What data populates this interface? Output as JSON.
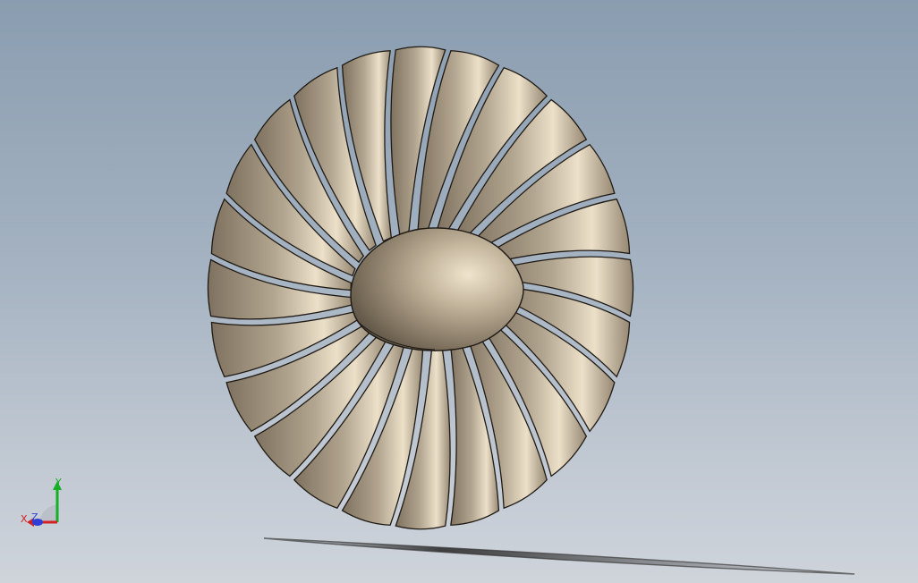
{
  "model": {
    "part_name": "fan-rotor",
    "blade_count": 24,
    "material_color": "#a39580",
    "hub_color": "#9b8c76",
    "edge_color": "#1f1a14"
  },
  "triad": {
    "x_label": "X",
    "y_label": "Y",
    "z_label": "Z",
    "x_color": "#d42020",
    "y_color": "#16b026",
    "z_color": "#2f3fd6"
  }
}
